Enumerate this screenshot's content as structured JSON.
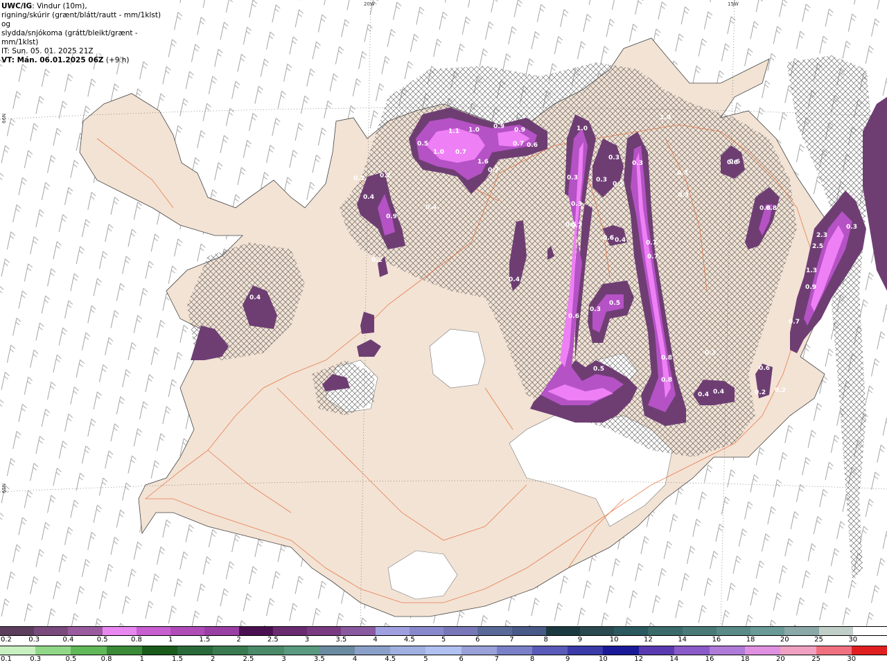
{
  "header": {
    "model": "UWC/IG",
    "line1": ": Vindur (10m),",
    "line2": "rigning/skúrir (grænt/blátt/rautt - mm/1klst) og",
    "line3": "slydda/snjókoma (grátt/bleikt/grænt - mm/1klst)",
    "init_time": "IT: Sun. 05. 01. 2025 21Z",
    "valid_time": "VT: Mán. 06.01.2025 06Z",
    "lead": " (+9 h)"
  },
  "coords": {
    "lon1": "20W",
    "lon2": "15W",
    "lat1": "66N",
    "lat2": "65N"
  },
  "precip_labels": [
    "1.1",
    "1.0",
    "1.0",
    "0.9",
    "0.9",
    "0.7",
    "0.5",
    "1.0",
    "0.7",
    "1.6",
    "0.7",
    "0.6",
    "0.2",
    "0.4",
    "0.9",
    "0.2",
    "0.4",
    "0.3",
    "0.3",
    "0.5",
    "0.3",
    "0.3",
    "0.3",
    "0.7",
    "0.2",
    "0.3",
    "0.6",
    "0.4",
    "0.2",
    "1.0",
    "0.6",
    "0.8",
    "0.6",
    "0.3",
    "0.4",
    "0.7",
    "0.7",
    "0.5",
    "0.3",
    "0.6",
    "0.5",
    "0.8",
    "0.8",
    "0.4",
    "0.4",
    "0.3",
    "0.2",
    "0.6",
    "0.8",
    "2.3",
    "2.5",
    "1.3",
    "0.9",
    "0.7",
    "0.3",
    "0.2",
    "0.6",
    "0.4"
  ],
  "legend_snow": {
    "ticks": [
      "0.2",
      "0.3",
      "0.4",
      "0.5",
      "0.8",
      "1",
      "1.5",
      "2",
      "2.5",
      "3",
      "3.5",
      "4",
      "4.5",
      "5",
      "6",
      "7",
      "8",
      "9",
      "10",
      "12",
      "14",
      "16",
      "18",
      "20",
      "25",
      "30"
    ],
    "colors": [
      "#5c3d5e",
      "#7b4a7c",
      "#9a5a9e",
      "#e887f0",
      "#c75fd0",
      "#b04cb8",
      "#9a3fa3",
      "#4a1050",
      "#6a2a70",
      "#7a3a82",
      "#8a5aa0",
      "#a0a0e0",
      "#8888cc",
      "#7878b8",
      "#5a6a98",
      "#4a5a88",
      "#1a3a40",
      "#2a4a50",
      "#2a5a60",
      "#3a6a6a",
      "#4a7a78",
      "#5a8a88",
      "#6a9a98",
      "#8aa8a8",
      "#c0d0c8",
      "#ffffff"
    ]
  },
  "legend_rain": {
    "ticks": [
      "0.1",
      "0.3",
      "0.5",
      "0.8",
      "1",
      "1.5",
      "2",
      "2.5",
      "3",
      "3.5",
      "4",
      "4.5",
      "5",
      "6",
      "7",
      "8",
      "9",
      "10",
      "12",
      "14",
      "16",
      "18",
      "20",
      "25",
      "30"
    ],
    "colors": [
      "#c8f0c0",
      "#90d888",
      "#60b858",
      "#3a8a38",
      "#1a5a1a",
      "#2a6a3a",
      "#3a7a50",
      "#4a8a68",
      "#5a9a80",
      "#6a8aa0",
      "#8aa0c8",
      "#a0b0e0",
      "#b0c0f0",
      "#9aa0d8",
      "#7a80c8",
      "#5a5ab8",
      "#3a3aa8",
      "#1a1a98",
      "#5a3ab0",
      "#8a5ac8",
      "#b07ad8",
      "#e090e0",
      "#f0a0c0",
      "#f07080",
      "#e02020"
    ]
  }
}
